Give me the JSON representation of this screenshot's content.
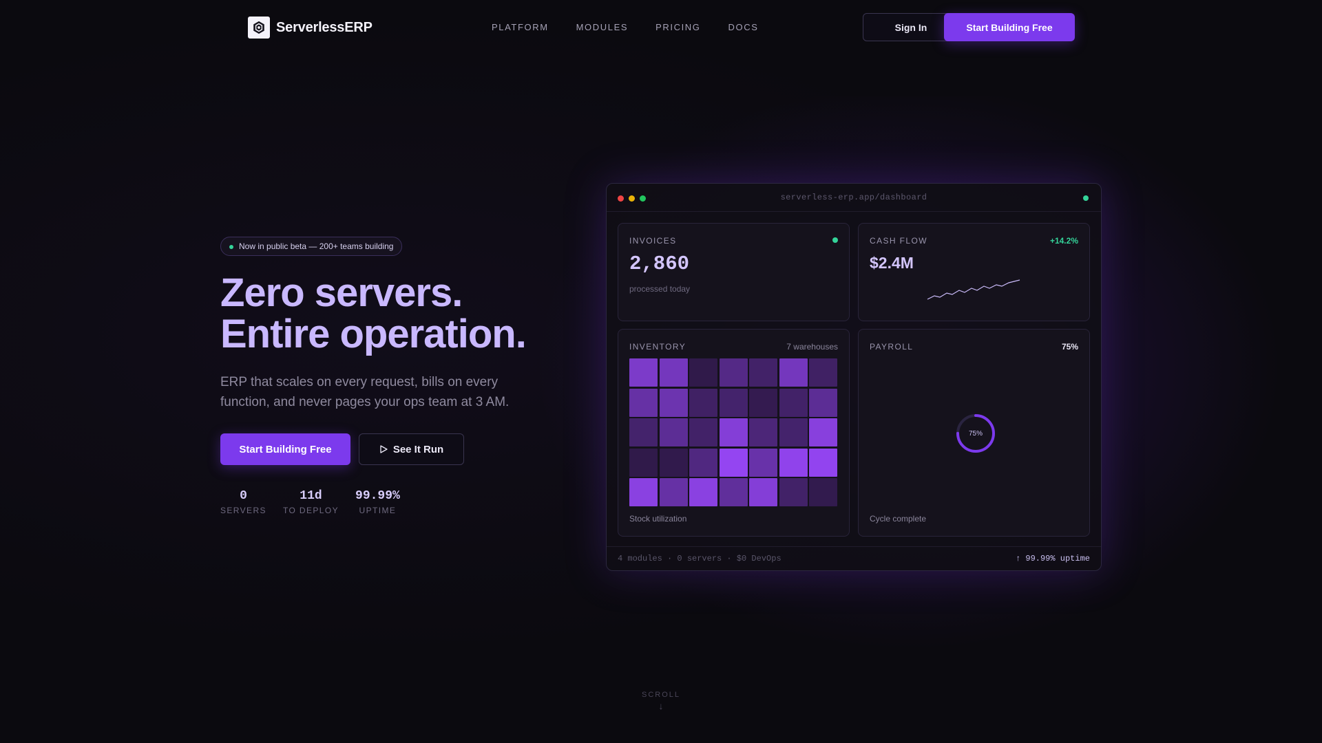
{
  "nav": {
    "brand": "ServerlessERP",
    "links": [
      "PLATFORM",
      "MODULES",
      "PRICING",
      "DOCS"
    ],
    "sign_in": "Sign In",
    "cta": "Start Building Free"
  },
  "hero": {
    "badge": "Now in public beta — 200+ teams building",
    "headline_1": "Zero servers.",
    "headline_2": "Entire operation.",
    "subtitle": "ERP that scales on every request, bills on every function, and never pages your ops team at 3 AM.",
    "cta_primary": "Start Building Free",
    "cta_secondary": "See It Run",
    "stats": [
      {
        "value": "0",
        "label": "SERVERS"
      },
      {
        "value": "11d",
        "label": "TO DEPLOY"
      },
      {
        "value": "99.99%",
        "label": "UPTIME"
      }
    ]
  },
  "dashboard": {
    "url": "serverless-erp.app/dashboard",
    "invoices": {
      "label": "INVOICES",
      "value": "2,860",
      "sub": "processed today"
    },
    "cashflow": {
      "label": "CASH FLOW",
      "value": "$2.4M",
      "change": "+14.2%"
    },
    "inventory": {
      "label": "INVENTORY",
      "meta": "7 warehouses",
      "footer": "Stock utilization",
      "levels": [
        [
          0.78,
          0.72,
          0.15,
          0.45,
          0.3,
          0.72,
          0.28
        ],
        [
          0.6,
          0.65,
          0.28,
          0.32,
          0.18,
          0.3,
          0.52
        ],
        [
          0.32,
          0.52,
          0.3,
          0.85,
          0.38,
          0.32,
          0.88
        ],
        [
          0.15,
          0.16,
          0.42,
          0.98,
          0.62,
          0.95,
          0.97
        ],
        [
          0.9,
          0.6,
          0.9,
          0.55,
          0.85,
          0.3,
          0.17
        ]
      ]
    },
    "payroll": {
      "label": "PAYROLL",
      "percent": "75%",
      "progress": 0.75,
      "ring_label": "75%",
      "footer": "Cycle complete"
    },
    "footer_left": "4 modules · 0 servers · $0 DevOps",
    "footer_right": "↑ 99.99% uptime"
  },
  "scroll": {
    "label": "SCROLL"
  },
  "colors": {
    "accent": "#7c3aed",
    "headline": "#c9b8ff",
    "status_green": "#34d399",
    "background": "#0b0a0f"
  }
}
